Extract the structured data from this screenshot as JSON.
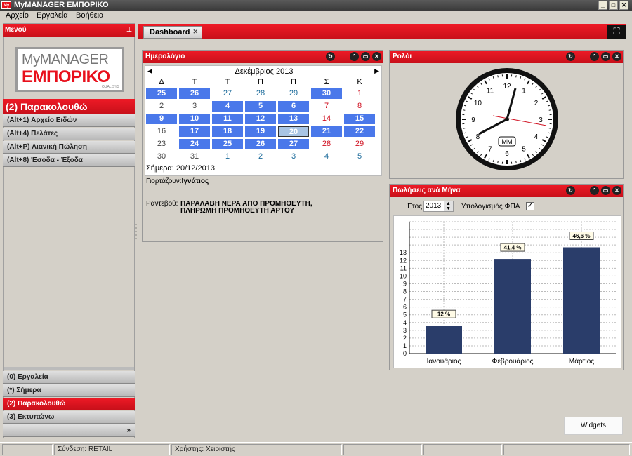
{
  "window": {
    "title": "MyMANAGER ΕΜΠΟΡΙΚΟ",
    "icon_text": "My"
  },
  "menubar": {
    "items": [
      "Αρχείο",
      "Εργαλεία",
      "Βοήθεια"
    ]
  },
  "left": {
    "header": "Μενού",
    "logo_top": "MyMANAGER",
    "logo_main": "ΕΜΠΟΡΙΚΟ",
    "logo_sub": "QUALISYS",
    "section_title": "(2) Παρακολουθώ",
    "nav": [
      "(Alt+1) Αρχείο Ειδών",
      "(Alt+4) Πελάτες",
      "(Alt+P) Λιανική Πώληση",
      "(Alt+8) Έσοδα - Έξοδα"
    ],
    "bottom_nav": [
      "(0) Εργαλεία",
      "(*) Σήμερα",
      "(2) Παρακολουθώ",
      "(3) Εκτυπώνω"
    ]
  },
  "tabs": {
    "dashboard": "Dashboard"
  },
  "calendar": {
    "title": "Ημερολόγιο",
    "month": "Δεκέμβριος 2013",
    "weekdays": [
      "Δ",
      "Τ",
      "Τ",
      "Π",
      "Π",
      "Σ",
      "Κ"
    ],
    "today_label": "Σήμερα: 20/12/2013",
    "namedays_label": "Γιορτάζουν:",
    "namedays_value": "Ιγνάτιος",
    "appointments_label": "Ραντεβού:",
    "appointments_line1": "ΠΑΡΑΛΑΒΗ ΝΕΡΑ ΑΠΟ ΠΡΟΜΗΘΕΥΤΗ,",
    "appointments_line2": "ΠΛΗΡΩΜΗ ΠΡΟΜΗΘΕΥΤΗ ΑΡΤΟΥ",
    "weeks": [
      [
        [
          "25",
          "sel"
        ],
        [
          "26",
          "sel"
        ],
        [
          "27",
          "teal"
        ],
        [
          "28",
          "teal"
        ],
        [
          "29",
          "teal"
        ],
        [
          "30",
          "sel"
        ],
        [
          "1",
          "red"
        ]
      ],
      [
        [
          "2",
          "gray"
        ],
        [
          "3",
          "gray"
        ],
        [
          "4",
          "sel"
        ],
        [
          "5",
          "sel"
        ],
        [
          "6",
          "sel"
        ],
        [
          "7",
          "red"
        ],
        [
          "8",
          "red"
        ]
      ],
      [
        [
          "9",
          "sel"
        ],
        [
          "10",
          "sel"
        ],
        [
          "11",
          "sel"
        ],
        [
          "12",
          "sel"
        ],
        [
          "13",
          "sel"
        ],
        [
          "14",
          "red"
        ],
        [
          "15",
          "sel"
        ]
      ],
      [
        [
          "16",
          "gray"
        ],
        [
          "17",
          "sel"
        ],
        [
          "18",
          "sel"
        ],
        [
          "19",
          "sel"
        ],
        [
          "20",
          "today"
        ],
        [
          "21",
          "sel"
        ],
        [
          "22",
          "sel"
        ]
      ],
      [
        [
          "23",
          "gray"
        ],
        [
          "24",
          "sel"
        ],
        [
          "25",
          "sel"
        ],
        [
          "26",
          "sel"
        ],
        [
          "27",
          "sel"
        ],
        [
          "28",
          "red"
        ],
        [
          "29",
          "red"
        ]
      ],
      [
        [
          "30",
          "gray"
        ],
        [
          "31",
          "gray"
        ],
        [
          "1",
          "teal"
        ],
        [
          "2",
          "teal"
        ],
        [
          "3",
          "teal"
        ],
        [
          "4",
          "teal"
        ],
        [
          "5",
          "teal"
        ]
      ]
    ]
  },
  "clock": {
    "title": "Ρολόι",
    "center_label": "MM",
    "numbers": [
      "12",
      "1",
      "2",
      "3",
      "4",
      "5",
      "6",
      "7",
      "8",
      "9",
      "10",
      "11"
    ]
  },
  "sales": {
    "title": "Πωλήσεις ανά Μήνα",
    "year_label": "Έτος",
    "year_value": "2013",
    "vat_label": "Υπολογισμός ΦΠΑ",
    "vat_checked": "✓"
  },
  "chart_data": {
    "type": "bar",
    "categories": [
      "Ιανουάριος",
      "Φεβρουάριος",
      "Μάρτιος"
    ],
    "values": [
      3.6,
      12.2,
      13.7
    ],
    "data_labels": [
      "12 %",
      "41,4 %",
      "46,6 %"
    ],
    "yticks": [
      0,
      1,
      2,
      3,
      4,
      5,
      6,
      7,
      8,
      9,
      10,
      11,
      12,
      13
    ],
    "ylim": [
      0,
      17
    ],
    "bar_color": "#2a3d6a",
    "grid": true
  },
  "widgets_label": "Widgets",
  "status": {
    "login": "Σύνδεση: RETAIL",
    "user": "Χρήστης: Χειριστής"
  }
}
